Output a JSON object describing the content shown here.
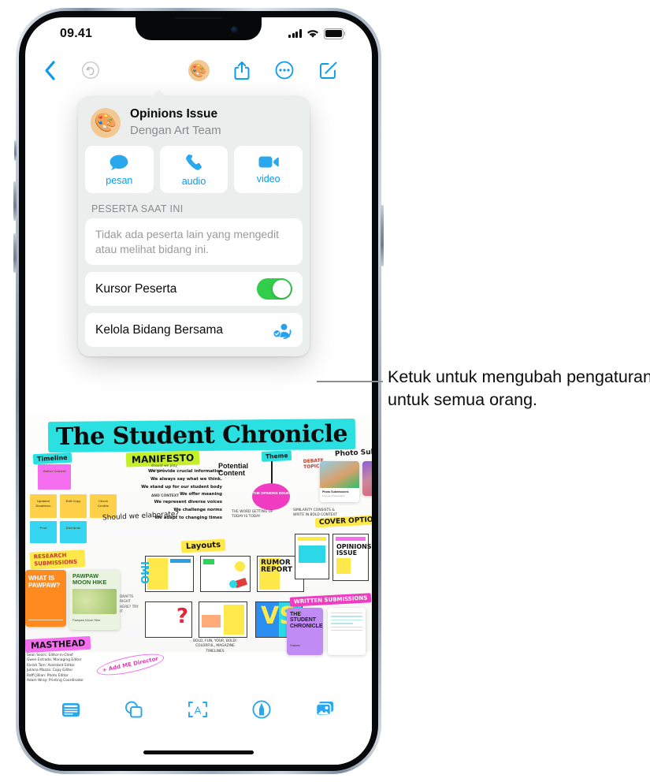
{
  "status_bar": {
    "time": "09.41",
    "signal_icon": "cellular-bars-icon",
    "wifi_icon": "wifi-icon",
    "battery_icon": "battery-icon"
  },
  "toolbar": {
    "back_icon": "chevron-left-icon",
    "undo_icon": "undo-arrow-icon",
    "collaborate_icon": "artist-palette-avatar-icon",
    "share_icon": "share-up-arrow-icon",
    "more_icon": "ellipsis-circle-icon",
    "compose_icon": "compose-pencil-icon"
  },
  "popover": {
    "title": "Opinions Issue",
    "subtitle": "Dengan Art Team",
    "avatar_icon": "artist-palette-avatar-icon",
    "actions": [
      {
        "label": "pesan",
        "icon": "message-bubble-icon"
      },
      {
        "label": "audio",
        "icon": "phone-handset-icon"
      },
      {
        "label": "video",
        "icon": "video-camera-icon"
      }
    ],
    "section_title": "PESERTA SAAT INI",
    "empty_note": "Tidak ada peserta lain yang mengedit atau melihat bidang ini.",
    "toggle_row": {
      "label": "Kursor Peserta",
      "state": "on",
      "on_color": "#32cd4b"
    },
    "manage_row": {
      "label": "Kelola Bidang Bersama",
      "icon": "person-badge-check-icon",
      "icon_color": "#23a2f0"
    }
  },
  "callout": {
    "text": "Ketuk untuk mengubah pengaturan untuk semua orang.",
    "line_color": "#8b8f94"
  },
  "bottom_toolbar": {
    "items": [
      {
        "icon": "note-card-icon"
      },
      {
        "icon": "shapes-icon"
      },
      {
        "icon": "text-box-a-icon"
      },
      {
        "icon": "pen-circle-icon"
      },
      {
        "icon": "media-photos-icon"
      }
    ]
  },
  "board": {
    "title": "The Student Chronicle",
    "title_highlight": "#2ae0e0",
    "labels": {
      "timeline": "Timeline",
      "research": "RESEARCH SUBMISSIONS",
      "masthead": "MASTHEAD",
      "manifesto": "MANIFESTO",
      "potential_content": "Potential Content",
      "theme": "Theme",
      "debate": "DEBATE TOPICS",
      "photo_submissions": "Photo Submission",
      "cover_options": "COVER OPTIONS",
      "written_submissions": "WRITTEN SUBMISSIONS",
      "layouts": "Layouts",
      "elaborate": "Should we elaborate?"
    },
    "manifesto_lines": [
      "We provide crucial information",
      "We always say what we think.",
      "We stand up for our student body",
      "We offer meaning",
      "We represent diverse voices",
      "We challenge norms",
      "We adapt to changing times"
    ],
    "sticky_notes": [
      {
        "text": "Gather Content",
        "color": "#f56ef0"
      },
      {
        "text": "Updated Deadlines",
        "color": "#ffd04a"
      },
      {
        "text": "Edit Copy",
        "color": "#ffd04a"
      },
      {
        "text": "Check Credits",
        "color": "#ffd04a"
      },
      {
        "text": "Print",
        "color": "#36d6f2"
      },
      {
        "text": "Distribute",
        "color": "#36d6f2"
      }
    ],
    "center_node": "THE OPINIONS ISSUE",
    "layout_words": [
      "IMO",
      "RUMOR REPORT",
      "VS"
    ],
    "research_cards": [
      {
        "title": "WHAT IS PAWPAW?",
        "color": "#ff8a1f"
      },
      {
        "title": "PAWPAW MOON HIKE",
        "subtitle": "Pawpaw Moon Hike",
        "color": "#eaf3df"
      }
    ],
    "cover_card": {
      "title": "THE STUDENT CHRONICLE",
      "color": "#c08bf5"
    },
    "side_notes": [
      "should we play videos?",
      "AND CONTEXT",
      "+ Add ME Director"
    ]
  }
}
